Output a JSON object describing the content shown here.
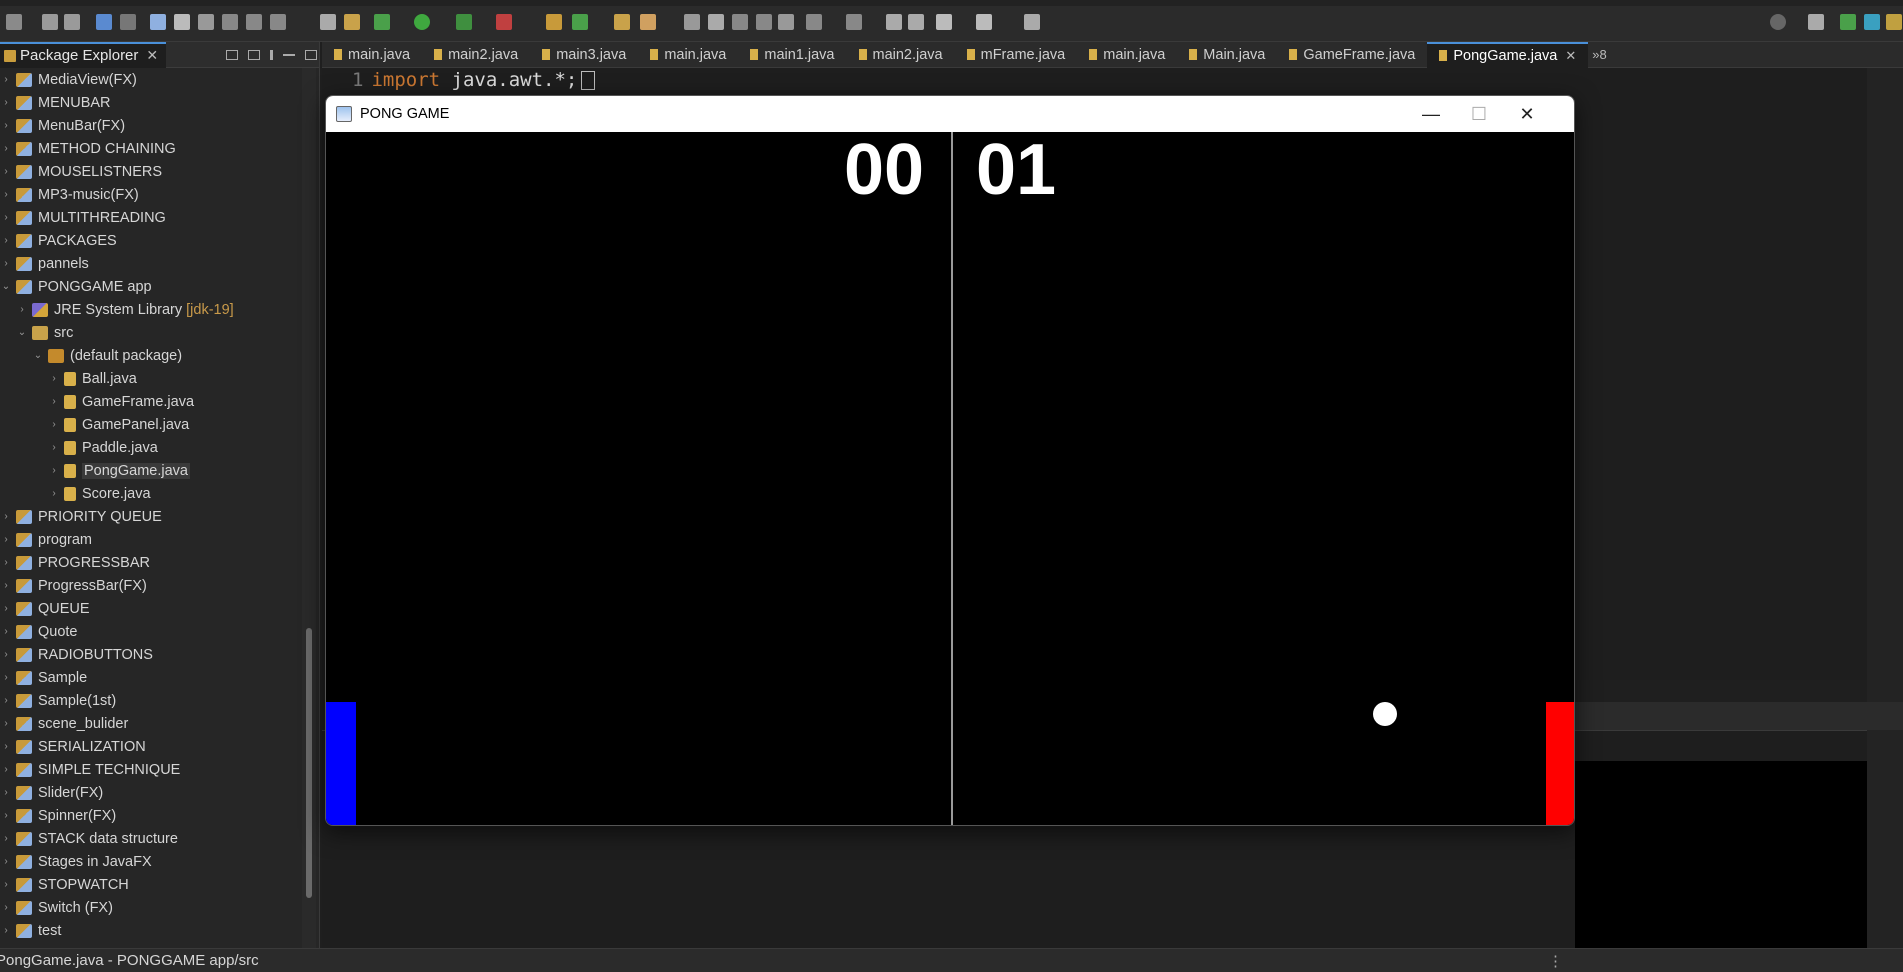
{
  "toolbar": {
    "icons": [
      "new-icon",
      "save-icon",
      "save-all-icon",
      "print-icon",
      "debug-icon",
      "run-icon",
      "stop-icon",
      "search-icon",
      "perspective-icon"
    ]
  },
  "package_explorer": {
    "title": "Package Explorer",
    "items": [
      {
        "label": "MediaView(FX)",
        "icon": "project-icon",
        "level": 0,
        "expanded": false
      },
      {
        "label": "MENUBAR",
        "icon": "project-icon",
        "level": 0,
        "expanded": false
      },
      {
        "label": "MenuBar(FX)",
        "icon": "project-icon",
        "level": 0,
        "expanded": false
      },
      {
        "label": "METHOD CHAINING",
        "icon": "project-icon",
        "level": 0,
        "expanded": false
      },
      {
        "label": "MOUSELISTNERS",
        "icon": "project-icon",
        "level": 0,
        "expanded": false
      },
      {
        "label": "MP3-music(FX)",
        "icon": "project-icon",
        "level": 0,
        "expanded": false
      },
      {
        "label": "MULTITHREADING",
        "icon": "project-icon",
        "level": 0,
        "expanded": false
      },
      {
        "label": "PACKAGES",
        "icon": "project-icon",
        "level": 0,
        "expanded": false
      },
      {
        "label": "pannels",
        "icon": "project-icon",
        "level": 0,
        "expanded": false
      },
      {
        "label": "PONGGAME app",
        "icon": "project-icon",
        "level": 0,
        "expanded": true
      },
      {
        "label": "JRE System Library",
        "suffix": "[jdk-19]",
        "icon": "library-icon",
        "level": 1,
        "expanded": false
      },
      {
        "label": "src",
        "icon": "folder-icon",
        "level": 1,
        "expanded": true
      },
      {
        "label": "(default package)",
        "icon": "package-icon",
        "level": 2,
        "expanded": true
      },
      {
        "label": "Ball.java",
        "icon": "java-file-icon",
        "level": 3,
        "expanded": false
      },
      {
        "label": "GameFrame.java",
        "icon": "java-file-icon",
        "level": 3,
        "expanded": false
      },
      {
        "label": "GamePanel.java",
        "icon": "java-file-icon",
        "level": 3,
        "expanded": false
      },
      {
        "label": "Paddle.java",
        "icon": "java-file-icon",
        "level": 3,
        "expanded": false
      },
      {
        "label": "PongGame.java",
        "icon": "java-file-icon",
        "level": 3,
        "expanded": false,
        "selected": true
      },
      {
        "label": "Score.java",
        "icon": "java-file-icon",
        "level": 3,
        "expanded": false
      },
      {
        "label": "PRIORITY QUEUE",
        "icon": "project-icon",
        "level": 0,
        "expanded": false
      },
      {
        "label": "program",
        "icon": "project-icon",
        "level": 0,
        "expanded": false
      },
      {
        "label": "PROGRESSBAR",
        "icon": "project-icon",
        "level": 0,
        "expanded": false
      },
      {
        "label": "ProgressBar(FX)",
        "icon": "project-icon",
        "level": 0,
        "expanded": false
      },
      {
        "label": "QUEUE",
        "icon": "project-icon",
        "level": 0,
        "expanded": false
      },
      {
        "label": "Quote",
        "icon": "project-icon",
        "level": 0,
        "expanded": false
      },
      {
        "label": "RADIOBUTTONS",
        "icon": "project-icon",
        "level": 0,
        "expanded": false
      },
      {
        "label": "Sample",
        "icon": "project-icon",
        "level": 0,
        "expanded": false
      },
      {
        "label": "Sample(1st)",
        "icon": "project-icon",
        "level": 0,
        "expanded": false
      },
      {
        "label": "scene_bulider",
        "icon": "project-icon",
        "level": 0,
        "expanded": false
      },
      {
        "label": "SERIALIZATION",
        "icon": "project-icon",
        "level": 0,
        "expanded": false
      },
      {
        "label": "SIMPLE TECHNIQUE",
        "icon": "project-icon",
        "level": 0,
        "expanded": false
      },
      {
        "label": "Slider(FX)",
        "icon": "project-icon",
        "level": 0,
        "expanded": false
      },
      {
        "label": "Spinner(FX)",
        "icon": "project-icon",
        "level": 0,
        "expanded": false
      },
      {
        "label": "STACK data structure",
        "icon": "project-icon",
        "level": 0,
        "expanded": false
      },
      {
        "label": "Stages in JavaFX",
        "icon": "project-icon",
        "level": 0,
        "expanded": false
      },
      {
        "label": "STOPWATCH",
        "icon": "project-icon",
        "level": 0,
        "expanded": false
      },
      {
        "label": "Switch (FX)",
        "icon": "project-icon",
        "level": 0,
        "expanded": false
      },
      {
        "label": "test",
        "icon": "project-icon",
        "level": 0,
        "expanded": false
      }
    ]
  },
  "editor_tabs": [
    {
      "label": "main.java",
      "active": false
    },
    {
      "label": "main2.java",
      "active": false
    },
    {
      "label": "main3.java",
      "active": false
    },
    {
      "label": "main.java",
      "active": false
    },
    {
      "label": "main1.java",
      "active": false
    },
    {
      "label": "main2.java",
      "active": false
    },
    {
      "label": "mFrame.java",
      "active": false
    },
    {
      "label": "main.java",
      "active": false
    },
    {
      "label": "Main.java",
      "active": false
    },
    {
      "label": "GameFrame.java",
      "active": false
    },
    {
      "label": "PongGame.java",
      "active": true
    }
  ],
  "overflow_count": "»8",
  "editor": {
    "line_number": "1",
    "fold_marker": "⊖",
    "keyword": "import",
    "code": " java.awt.*;"
  },
  "game_window": {
    "title": "PONG GAME",
    "minimize": "—",
    "maximize": "☐",
    "close": "✕",
    "score_left": "00",
    "score_right": "01",
    "colors": {
      "left_paddle": "#0000ff",
      "right_paddle": "#ff0000",
      "ball": "#ffffff",
      "background": "#000000"
    }
  },
  "statusbar": {
    "text": "PongGame.java - PONGGAME app/src",
    "menu_dots": "⋮"
  }
}
